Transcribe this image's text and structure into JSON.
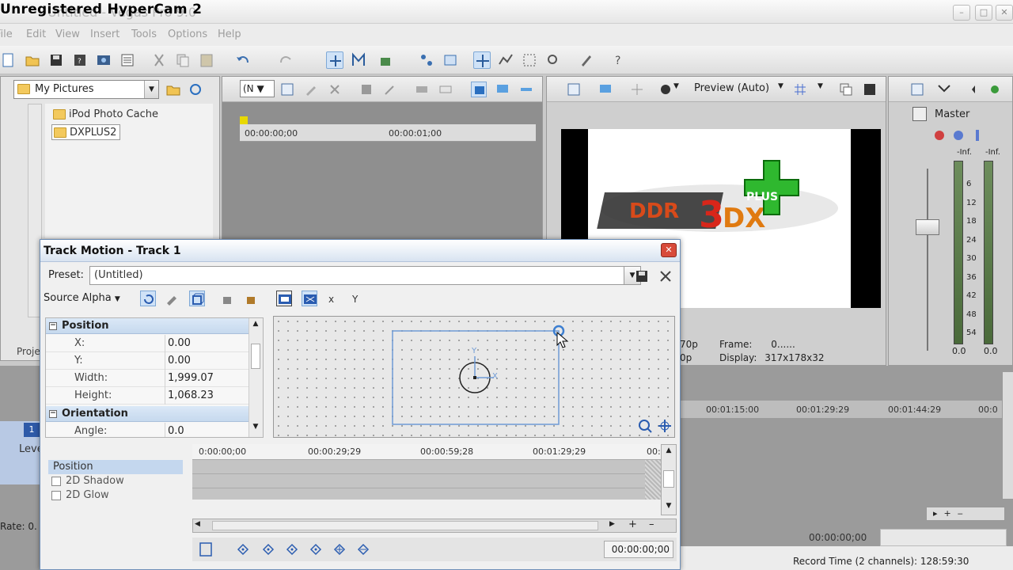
{
  "watermark": "Unregistered HyperCam 2",
  "window": {
    "ghost_title": "Untitled - Vegas Pro 9.0",
    "minimize": "–",
    "maximize": "□",
    "close": "✕"
  },
  "menu": [
    "File",
    "Edit",
    "View",
    "Insert",
    "Tools",
    "Options",
    "Help"
  ],
  "explorer": {
    "path": "My Pictures",
    "folders": [
      {
        "label": "iPod Photo Cache",
        "selected": false
      },
      {
        "label": "DXPLUS2",
        "selected": true
      }
    ],
    "tab_label": "Proje"
  },
  "trimmer": {
    "mode_button": "(N",
    "ruler": [
      "00:00:00;00",
      "00:00:01;00"
    ]
  },
  "preview": {
    "quality_label": "Preview (Auto)",
    "info": {
      "frame_label": "Frame:",
      "frame_value": "0......",
      "display_label": "Display:",
      "display_value": "317x178x32",
      "left_row1": "70p",
      "left_row2": "0p"
    }
  },
  "mixer": {
    "title": "Master",
    "peak_left": "-Inf.",
    "peak_right": "-Inf.",
    "scale": [
      "6",
      "12",
      "18",
      "24",
      "30",
      "36",
      "42",
      "48",
      "54"
    ],
    "value_left": "0.0",
    "value_right": "0.0"
  },
  "timeline": {
    "ruler": [
      "00:01:15:00",
      "00:01:29:29",
      "00:01:44:29",
      "00:0"
    ],
    "level_label": "Leve",
    "track_number": "1",
    "rate_label": "Rate: 0.",
    "record_time": "Record Time (2 channels): 128:59:30",
    "time_display": "00:00:00;00"
  },
  "dialog": {
    "title": "Track Motion - Track 1",
    "close": "✕",
    "preset_label": "Preset:",
    "preset_value": "(Untitled)",
    "source_alpha_label": "Source Alpha",
    "sections": {
      "position": {
        "header": "Position",
        "rows": [
          {
            "key": "X:",
            "value": "0.00"
          },
          {
            "key": "Y:",
            "value": "0.00"
          },
          {
            "key": "Width:",
            "value": "1,999.07"
          },
          {
            "key": "Height:",
            "value": "1,068.23"
          }
        ]
      },
      "orientation": {
        "header": "Orientation",
        "rows": [
          {
            "key": "Angle:",
            "value": "0.0"
          }
        ]
      }
    },
    "canvas": {
      "x_axis": "X",
      "y_axis": "Y"
    },
    "keyframe_ruler": [
      "0:00:00;00",
      "00:00:29;29",
      "00:00:59;28",
      "00:01:29;29",
      "00:"
    ],
    "keyframe_tracks": [
      {
        "label": "Position",
        "header": true
      },
      {
        "label": "2D Shadow",
        "header": false
      },
      {
        "label": "2D Glow",
        "header": false
      }
    ],
    "time_display": "00:00:00;00"
  },
  "colors": {
    "accent": "#3d7fd1",
    "selection": "#c4d7ee",
    "dialog_border": "#6e8fb8"
  }
}
